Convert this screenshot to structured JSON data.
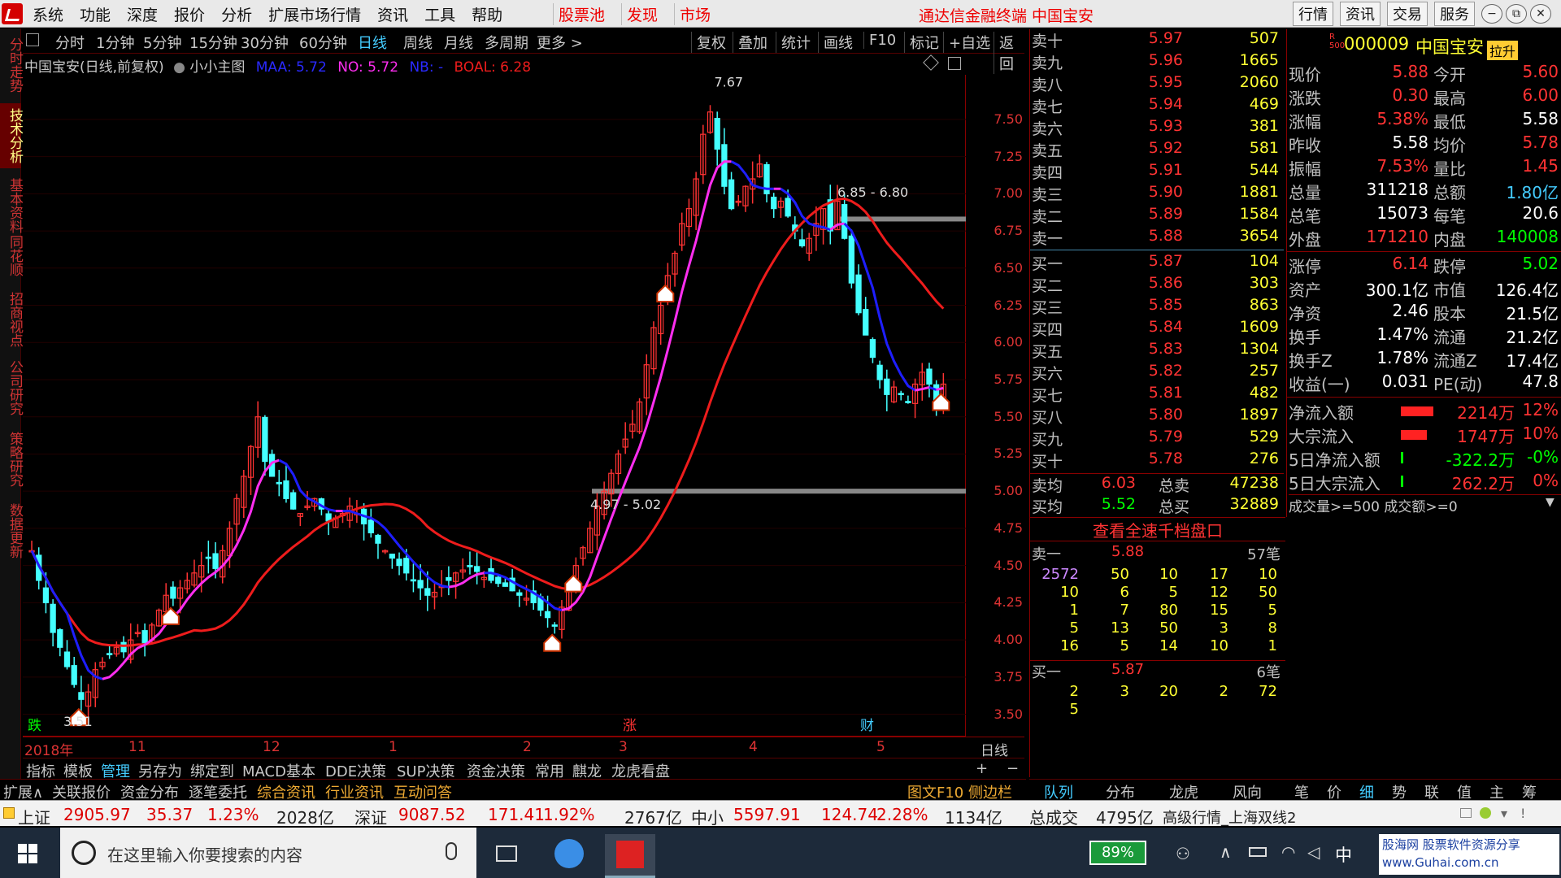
{
  "menubar": {
    "left_items": [
      "系统",
      "功能",
      "深度",
      "报价",
      "分析",
      "扩展市场行情",
      "资讯",
      "工具",
      "帮助"
    ],
    "highlight_items": [
      "股票池",
      "发现",
      "市场"
    ],
    "title": "通达信金融终端  中国宝安",
    "right_items": [
      "行情",
      "资讯",
      "交易",
      "服务"
    ],
    "win_buttons": [
      "−",
      "⧉",
      "✕"
    ]
  },
  "sidebar": [
    "分时走势",
    "技术分析",
    "基本资料",
    "同花顺",
    "招商视点",
    "公司研究",
    "策略研究",
    "数据更新"
  ],
  "periods": [
    "分时",
    "1分钟",
    "5分钟",
    "15分钟",
    "30分钟",
    "60分钟",
    "日线",
    "周线",
    "月线",
    "多周期",
    "更多 >"
  ],
  "active_period": "日线",
  "chart_tools": [
    "复权",
    "叠加",
    "统计",
    "画线",
    "F10",
    "标记",
    "+自选",
    "返回"
  ],
  "chart_info": {
    "name": "中国宝安(日线,前复权)",
    "indicator": "小小主图",
    "maa": "MAA: 5.72",
    "no": "NO: 5.72",
    "nb": "NB: -",
    "boal": "BOAL: 6.28"
  },
  "chart_data": {
    "type": "candlestick",
    "y_ticks": [
      "7.50",
      "7.25",
      "7.00",
      "6.75",
      "6.50",
      "6.25",
      "6.00",
      "5.75",
      "5.50",
      "5.25",
      "5.00",
      "4.75",
      "4.50",
      "4.25",
      "4.00",
      "3.75",
      "3.50"
    ],
    "ylim": [
      3.35,
      7.8
    ],
    "x_labels": [
      "2018年",
      "11",
      "12",
      "1",
      "2",
      "3",
      "4",
      "5"
    ],
    "annotations": {
      "high": "7.67",
      "low": "3.51",
      "band_high": "6.85 - 6.80",
      "band_low": "4.97 - 5.02"
    },
    "markers": [
      "跌",
      "涨",
      "财"
    ],
    "right_label": "日线",
    "closes": [
      4.6,
      4.4,
      4.25,
      4.05,
      3.95,
      3.82,
      3.7,
      3.6,
      3.65,
      3.8,
      3.85,
      3.9,
      3.95,
      3.92,
      4.0,
      4.05,
      3.98,
      4.1,
      4.2,
      4.3,
      4.28,
      4.35,
      4.4,
      4.45,
      4.5,
      4.55,
      4.48,
      4.6,
      4.75,
      4.95,
      5.1,
      5.3,
      5.5,
      5.2,
      5.1,
      5.05,
      4.95,
      4.88,
      4.85,
      4.9,
      4.95,
      4.88,
      4.8,
      4.82,
      4.85,
      4.9,
      4.85,
      4.78,
      4.72,
      4.65,
      4.6,
      4.55,
      4.5,
      4.45,
      4.4,
      4.35,
      4.3,
      4.32,
      4.36,
      4.4,
      4.45,
      4.47,
      4.5,
      4.46,
      4.42,
      4.4,
      4.38,
      4.36,
      4.33,
      4.3,
      4.28,
      4.25,
      4.2,
      4.15,
      4.1,
      4.22,
      4.35,
      4.5,
      4.62,
      4.75,
      4.9,
      5.0,
      5.12,
      5.25,
      5.35,
      5.45,
      5.6,
      5.85,
      6.1,
      6.25,
      6.45,
      6.6,
      6.8,
      6.9,
      7.1,
      7.4,
      7.55,
      7.3,
      7.05,
      6.9,
      6.95,
      7.05,
      7.1,
      7.2,
      7.0,
      6.9,
      6.95,
      6.85,
      6.75,
      6.65,
      6.7,
      6.8,
      6.9,
      6.75,
      6.95,
      6.7,
      6.4,
      6.2,
      6.05,
      5.9,
      5.75,
      5.65,
      5.7,
      5.65,
      5.6,
      5.72,
      5.8,
      5.72,
      5.6,
      5.72
    ],
    "series": [
      {
        "name": "MAA",
        "color": "#1e1eff"
      },
      {
        "name": "NO",
        "color": "#ff2ef0"
      },
      {
        "name": "BOAL",
        "color": "#ee1c1c"
      }
    ]
  },
  "bottom_tabs": [
    "指标",
    "模板",
    "管理",
    "另存为",
    "绑定到",
    "MACD基本",
    "DDE决策",
    "SUP决策",
    "资金决策",
    "常用",
    "麒龙",
    "龙虎看盘"
  ],
  "bottom_tabs2": [
    "扩展∧",
    "关联报价",
    "资金分布",
    "逐笔委托",
    "综合资讯",
    "行业资讯",
    "互动问答"
  ],
  "bottom_tabs2_right": "图文F10 侧边栏 《",
  "plus_minus": [
    "+",
    "−"
  ],
  "orderbook": {
    "asks": [
      {
        "label": "卖十",
        "price": "5.97",
        "vol": "507"
      },
      {
        "label": "卖九",
        "price": "5.96",
        "vol": "1665"
      },
      {
        "label": "卖八",
        "price": "5.95",
        "vol": "2060"
      },
      {
        "label": "卖七",
        "price": "5.94",
        "vol": "469"
      },
      {
        "label": "卖六",
        "price": "5.93",
        "vol": "381"
      },
      {
        "label": "卖五",
        "price": "5.92",
        "vol": "581"
      },
      {
        "label": "卖四",
        "price": "5.91",
        "vol": "544"
      },
      {
        "label": "卖三",
        "price": "5.90",
        "vol": "1881"
      },
      {
        "label": "卖二",
        "price": "5.89",
        "vol": "1584"
      },
      {
        "label": "卖一",
        "price": "5.88",
        "vol": "3654"
      }
    ],
    "bids": [
      {
        "label": "买一",
        "price": "5.87",
        "vol": "104"
      },
      {
        "label": "买二",
        "price": "5.86",
        "vol": "303"
      },
      {
        "label": "买三",
        "price": "5.85",
        "vol": "863"
      },
      {
        "label": "买四",
        "price": "5.84",
        "vol": "1609"
      },
      {
        "label": "买五",
        "price": "5.83",
        "vol": "1304"
      },
      {
        "label": "买六",
        "price": "5.82",
        "vol": "257"
      },
      {
        "label": "买七",
        "price": "5.81",
        "vol": "482"
      },
      {
        "label": "买八",
        "price": "5.80",
        "vol": "1897"
      },
      {
        "label": "买九",
        "price": "5.79",
        "vol": "529"
      },
      {
        "label": "买十",
        "price": "5.78",
        "vol": "276"
      }
    ],
    "avg_sell": {
      "label": "卖均",
      "price": "6.03",
      "label2": "总卖",
      "vol": "47238"
    },
    "avg_buy": {
      "label": "买均",
      "price": "5.52",
      "label2": "总买",
      "vol": "32889"
    }
  },
  "quote": {
    "code": "000009",
    "name": "中国宝安",
    "badge": "拉升",
    "rows": [
      [
        "现价",
        "5.88",
        "今开",
        "5.60"
      ],
      [
        "涨跌",
        "0.30",
        "最高",
        "6.00"
      ],
      [
        "涨幅",
        "5.38%",
        "最低",
        "5.58"
      ],
      [
        "昨收",
        "5.58",
        "均价",
        "5.78"
      ],
      [
        "振幅",
        "7.53%",
        "量比",
        "1.45"
      ],
      [
        "总量",
        "311218",
        "总额",
        "1.80亿"
      ],
      [
        "总笔",
        "15073",
        "每笔",
        "20.6"
      ],
      [
        "外盘",
        "171210",
        "内盘",
        "140008"
      ]
    ],
    "rows2": [
      [
        "涨停",
        "6.14",
        "跌停",
        "5.02"
      ],
      [
        "资产",
        "300.1亿",
        "市值",
        "126.4亿"
      ],
      [
        "净资",
        "2.46",
        "股本",
        "21.5亿"
      ],
      [
        "换手",
        "1.47%",
        "流通",
        "21.2亿"
      ],
      [
        "换手Z",
        "1.78%",
        "流通Z",
        "17.4亿"
      ],
      [
        "收益(一)",
        "0.031",
        "PE(动)",
        "47.8"
      ]
    ],
    "flows": [
      [
        "净流入额",
        "2214万",
        "12%"
      ],
      [
        "大宗流入",
        "1747万",
        "10%"
      ],
      [
        "5日净流入额",
        "-322.2万",
        "-0%"
      ],
      [
        "5日大宗流入",
        "262.2万",
        "0%"
      ]
    ],
    "filter": "成交量>=500 成交额>=0"
  },
  "level2": {
    "title": "查看全速千档盘口",
    "sell1": {
      "label": "卖一",
      "price": "5.88",
      "count": "57笔"
    },
    "sell_grid": [
      [
        "2572",
        "50",
        "10",
        "17",
        "10"
      ],
      [
        "10",
        "6",
        "5",
        "12",
        "50"
      ],
      [
        "1",
        "7",
        "80",
        "15",
        "5"
      ],
      [
        "5",
        "13",
        "50",
        "3",
        "8"
      ],
      [
        "16",
        "5",
        "14",
        "10",
        "1"
      ]
    ],
    "buy1": {
      "label": "买一",
      "price": "5.87",
      "count": "6笔"
    },
    "buy_grid": [
      [
        "2",
        "3",
        "20",
        "2",
        "72"
      ],
      [
        "5"
      ]
    ]
  },
  "panel_tabs": [
    "队列",
    "分布",
    "龙虎",
    "风向",
    "笔",
    "价",
    "细",
    "势",
    "联",
    "值",
    "主",
    "筹"
  ],
  "indexbar": {
    "sh_label": "上证",
    "sh_val": "2905.97",
    "sh_chg": "35.37",
    "sh_pct": "1.23%",
    "sh_amt": "2028亿",
    "sz_label": "深证",
    "sz_val": "9087.52",
    "sz_chg": "171.41",
    "sz_pct": "1.92%",
    "sz_amt": "2767亿",
    "zx_label": "中小",
    "zx_val": "5597.91",
    "zx_chg": "124.74",
    "zx_pct": "2.28%",
    "zx_amt": "1134亿",
    "total_label": "总成交",
    "total_val": "4795亿",
    "server": "高级行情_上海双线2"
  },
  "taskbar": {
    "search_placeholder": "在这里输入你要搜索的内容",
    "battery": "89%",
    "ime": "中",
    "watermark": "股海网 股票软件资源分享 www.Guhai.com.cn"
  }
}
